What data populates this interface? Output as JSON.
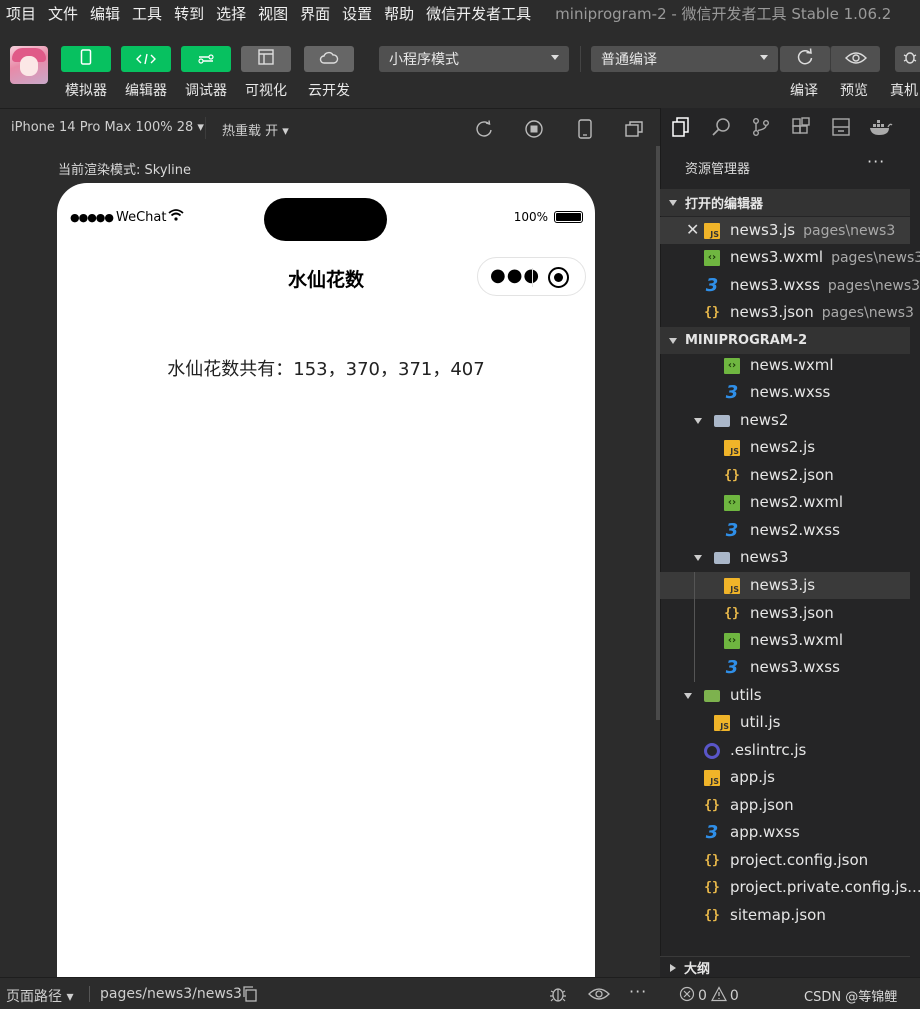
{
  "menubar": {
    "items": [
      "项目",
      "文件",
      "编辑",
      "工具",
      "转到",
      "选择",
      "视图",
      "界面",
      "设置",
      "帮助",
      "微信开发者工具"
    ],
    "window_title": "miniprogram-2 - 微信开发者工具 Stable 1.06.2"
  },
  "toolbar": {
    "buttons": [
      {
        "label": "模拟器",
        "icon": "phone-icon"
      },
      {
        "label": "编辑器",
        "icon": "code-icon"
      },
      {
        "label": "调试器",
        "icon": "debug-icon"
      },
      {
        "label": "可视化",
        "icon": "layout-icon"
      },
      {
        "label": "云开发",
        "icon": "cloud-icon"
      }
    ],
    "mode_select": "小程序模式",
    "compile_select": "普通编译",
    "right_labels": {
      "compile": "编译",
      "preview": "预览",
      "real_device": "真机"
    }
  },
  "devicebar": {
    "device": "iPhone 14 Pro Max 100% 28",
    "hot_reload": "热重载 开"
  },
  "simulator": {
    "render_mode": "当前渲染模式: Skyline",
    "status_carrier": "WeChat",
    "status_battery": "100%",
    "nav_title": "水仙花数",
    "content": "水仙花数共有：153，370，371，407"
  },
  "explorer": {
    "header": "资源管理器",
    "open_editors_title": "打开的编辑器",
    "open_editors": [
      {
        "name": "news3.js",
        "path": "pages\\news3",
        "type": "js"
      },
      {
        "name": "news3.wxml",
        "path": "pages\\news3",
        "type": "wxml"
      },
      {
        "name": "news3.wxss",
        "path": "pages\\news3",
        "type": "wxss"
      },
      {
        "name": "news3.json",
        "path": "pages\\news3",
        "type": "json"
      }
    ],
    "project_title": "MINIPROGRAM-2",
    "tree": [
      {
        "name": "news.wxml",
        "type": "wxml"
      },
      {
        "name": "news.wxss",
        "type": "wxss"
      },
      {
        "name": "news2",
        "type": "folder"
      },
      {
        "name": "news2.js",
        "type": "js"
      },
      {
        "name": "news2.json",
        "type": "json"
      },
      {
        "name": "news2.wxml",
        "type": "wxml"
      },
      {
        "name": "news2.wxss",
        "type": "wxss"
      },
      {
        "name": "news3",
        "type": "folder"
      },
      {
        "name": "news3.js",
        "type": "js"
      },
      {
        "name": "news3.json",
        "type": "json"
      },
      {
        "name": "news3.wxml",
        "type": "wxml"
      },
      {
        "name": "news3.wxss",
        "type": "wxss"
      },
      {
        "name": "utils",
        "type": "folder-green"
      },
      {
        "name": "util.js",
        "type": "js"
      },
      {
        "name": ".eslintrc.js",
        "type": "eslint"
      },
      {
        "name": "app.js",
        "type": "js"
      },
      {
        "name": "app.json",
        "type": "json"
      },
      {
        "name": "app.wxss",
        "type": "wxss"
      },
      {
        "name": "project.config.json",
        "type": "json"
      },
      {
        "name": "project.private.config.js...",
        "type": "json"
      },
      {
        "name": "sitemap.json",
        "type": "json"
      }
    ],
    "outline_title": "大纲"
  },
  "bottombar": {
    "page_path_label": "页面路径",
    "page_path": "pages/news3/news3",
    "errors": "0",
    "warnings": "0",
    "watermark": "CSDN @等锦鲤"
  },
  "colors": {
    "accent_green": "#07c160",
    "panel": "#252526",
    "background": "#2c2c2c"
  }
}
